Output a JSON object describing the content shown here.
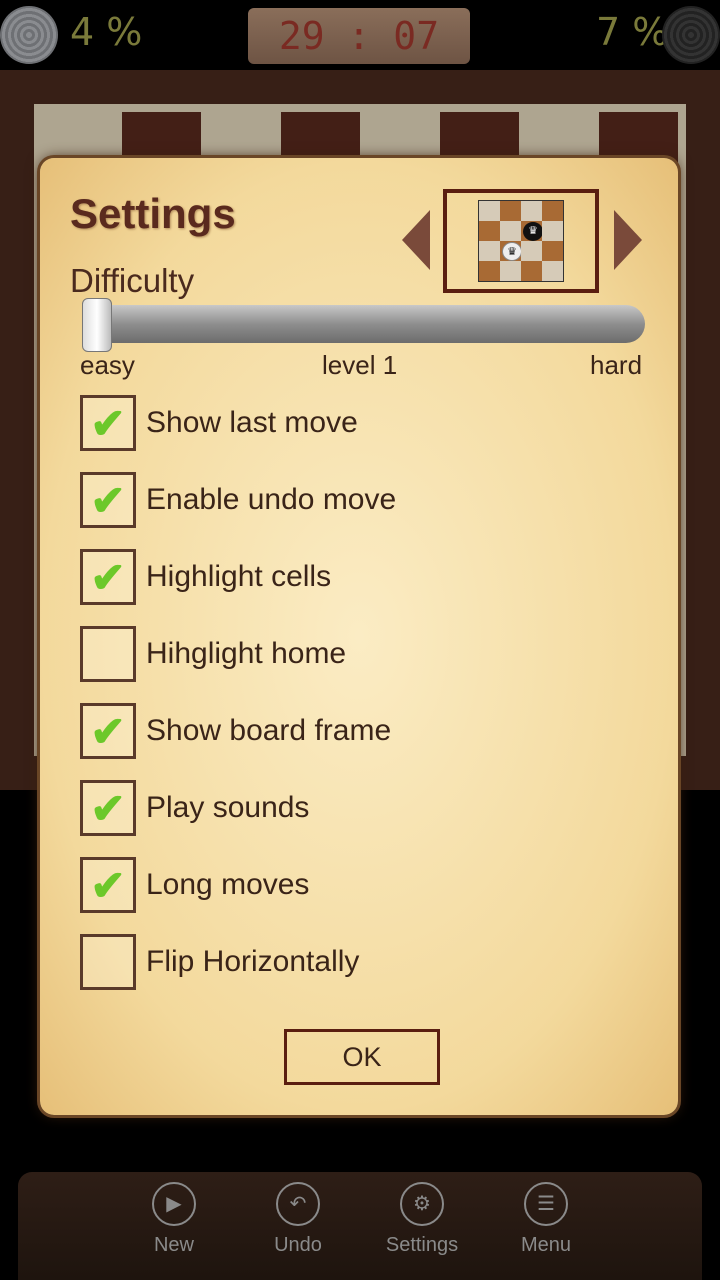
{
  "header": {
    "left_percent": "4 %",
    "timer": "29 : 07",
    "right_percent": "7 %"
  },
  "settings": {
    "title": "Settings",
    "difficulty_label": "Difficulty",
    "difficulty_level": 1,
    "slider_fraction": 0.0,
    "easy_label": "easy",
    "level_label": "level 1",
    "hard_label": "hard",
    "options": [
      {
        "label": "Show last move",
        "checked": true
      },
      {
        "label": "Enable undo move",
        "checked": true
      },
      {
        "label": "Highlight cells",
        "checked": true
      },
      {
        "label": "Hihglight home",
        "checked": false
      },
      {
        "label": "Show board frame",
        "checked": true
      },
      {
        "label": "Play sounds",
        "checked": true
      },
      {
        "label": "Long moves",
        "checked": true
      },
      {
        "label": "Flip Horizontally",
        "checked": false
      }
    ],
    "ok_label": "OK"
  },
  "bottom_nav": [
    {
      "label": "New",
      "icon": "play-icon"
    },
    {
      "label": "Undo",
      "icon": "undo-icon"
    },
    {
      "label": "Settings",
      "icon": "gear-icon"
    },
    {
      "label": "Menu",
      "icon": "list-icon"
    }
  ],
  "colors": {
    "check": "#6cc82a",
    "text": "#3a2418",
    "accent": "#5a1e10"
  }
}
